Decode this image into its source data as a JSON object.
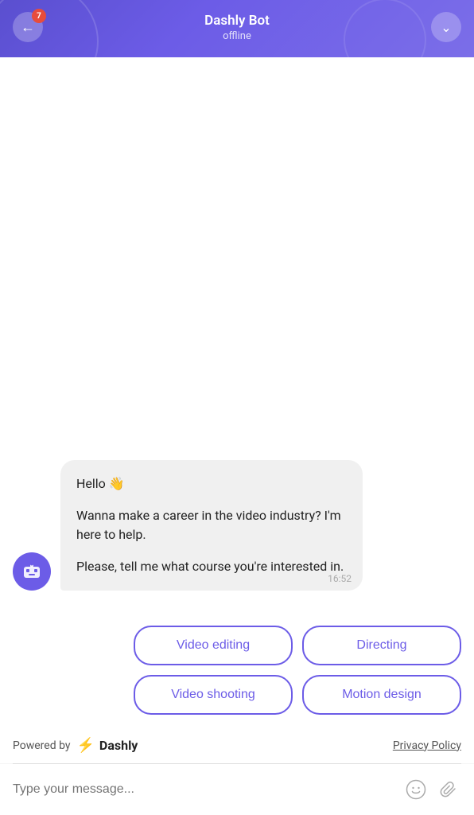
{
  "header": {
    "title": "Dashly Bot",
    "subtitle": "offline",
    "back_label": "←",
    "badge_count": "7",
    "chevron_label": "∨"
  },
  "chat": {
    "bot_message": {
      "greeting": "Hello 👋",
      "para1": "Wanna make a career in the video industry? I'm here to help.",
      "para2": "Please, tell me what course you're interested in.",
      "time": "16:52"
    }
  },
  "options": {
    "row1": [
      {
        "label": "Video editing"
      },
      {
        "label": "Directing"
      }
    ],
    "row2": [
      {
        "label": "Video shooting"
      },
      {
        "label": "Motion design"
      }
    ]
  },
  "footer": {
    "powered_by": "Powered by",
    "brand": "Dashly",
    "privacy": "Privacy Policy"
  },
  "input": {
    "placeholder": "Type your message..."
  },
  "icons": {
    "back": "←",
    "chevron_down": "∨",
    "emoji": "☺",
    "attach": "📎"
  }
}
